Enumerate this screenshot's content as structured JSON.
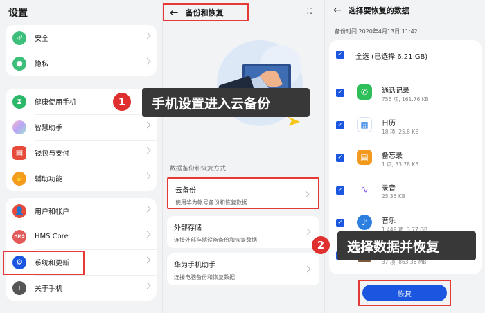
{
  "settings": {
    "title": "设置",
    "group1": [
      {
        "label": "安全",
        "icon": "shield-icon",
        "color": "#3cbf7a"
      },
      {
        "label": "隐私",
        "icon": "privacy-icon",
        "color": "#3cbf7a"
      }
    ],
    "group2": [
      {
        "label": "健康使用手机",
        "icon": "hourglass-icon",
        "color": "#2cb86a"
      },
      {
        "label": "智慧助手",
        "icon": "assistant-icon",
        "color": "#f2a7c8"
      },
      {
        "label": "钱包与支付",
        "icon": "wallet-icon",
        "color": "#e64a3b"
      },
      {
        "label": "辅助功能",
        "icon": "hand-icon",
        "color": "#f59b1b"
      }
    ],
    "group3": [
      {
        "label": "用户和帐户",
        "icon": "user-icon",
        "color": "#e64a3b"
      },
      {
        "label": "HMS Core",
        "icon": "hms-icon",
        "color": "#e25a5a"
      },
      {
        "label": "系统和更新",
        "icon": "gear-icon",
        "color": "#1a56e0"
      },
      {
        "label": "关于手机",
        "icon": "info-icon",
        "color": "#555555"
      }
    ]
  },
  "backup": {
    "title": "备份和恢复",
    "section_label": "数据备份和恢复方式",
    "options": [
      {
        "title": "云备份",
        "subtitle": "使用华为帐号备份和恢复数据"
      },
      {
        "title": "外部存储",
        "subtitle": "连接外部存储设备备份和恢复数据"
      },
      {
        "title": "华为手机助手",
        "subtitle": "连接电脑备份和恢复数据"
      }
    ]
  },
  "restore": {
    "title": "选择要恢复的数据",
    "backup_time": "备份时间 2020年4月13日 11:42",
    "select_all": "全选 (已选择 6.21 GB)",
    "items": [
      {
        "name": "通话记录",
        "meta": "756 项,  161.76 KB",
        "icon": "phone-icon",
        "color": "#2fbf5a"
      },
      {
        "name": "日历",
        "meta": "18 项,  25.8 KB",
        "icon": "calendar-icon",
        "color": "#2d7fe0"
      },
      {
        "name": "备忘录",
        "meta": "1 项,  33.78 KB",
        "icon": "notes-icon",
        "color": "#f39a1e"
      },
      {
        "name": "录音",
        "meta": "25.35 KB",
        "icon": "recorder-icon",
        "color": "#8a5cf0"
      },
      {
        "name": "音乐",
        "meta": "1 449 项,  3.77 GB",
        "icon": "music-icon",
        "color": "#2d7fe0"
      },
      {
        "name": "",
        "meta": "37 项,  863.36 MB",
        "icon": "video-icon",
        "color": "#7a5a3a"
      }
    ],
    "button_label": "恢复"
  },
  "callouts": [
    {
      "num": "1",
      "text": "手机设置进入云备份"
    },
    {
      "num": "2",
      "text": "选择数据并恢复"
    }
  ]
}
